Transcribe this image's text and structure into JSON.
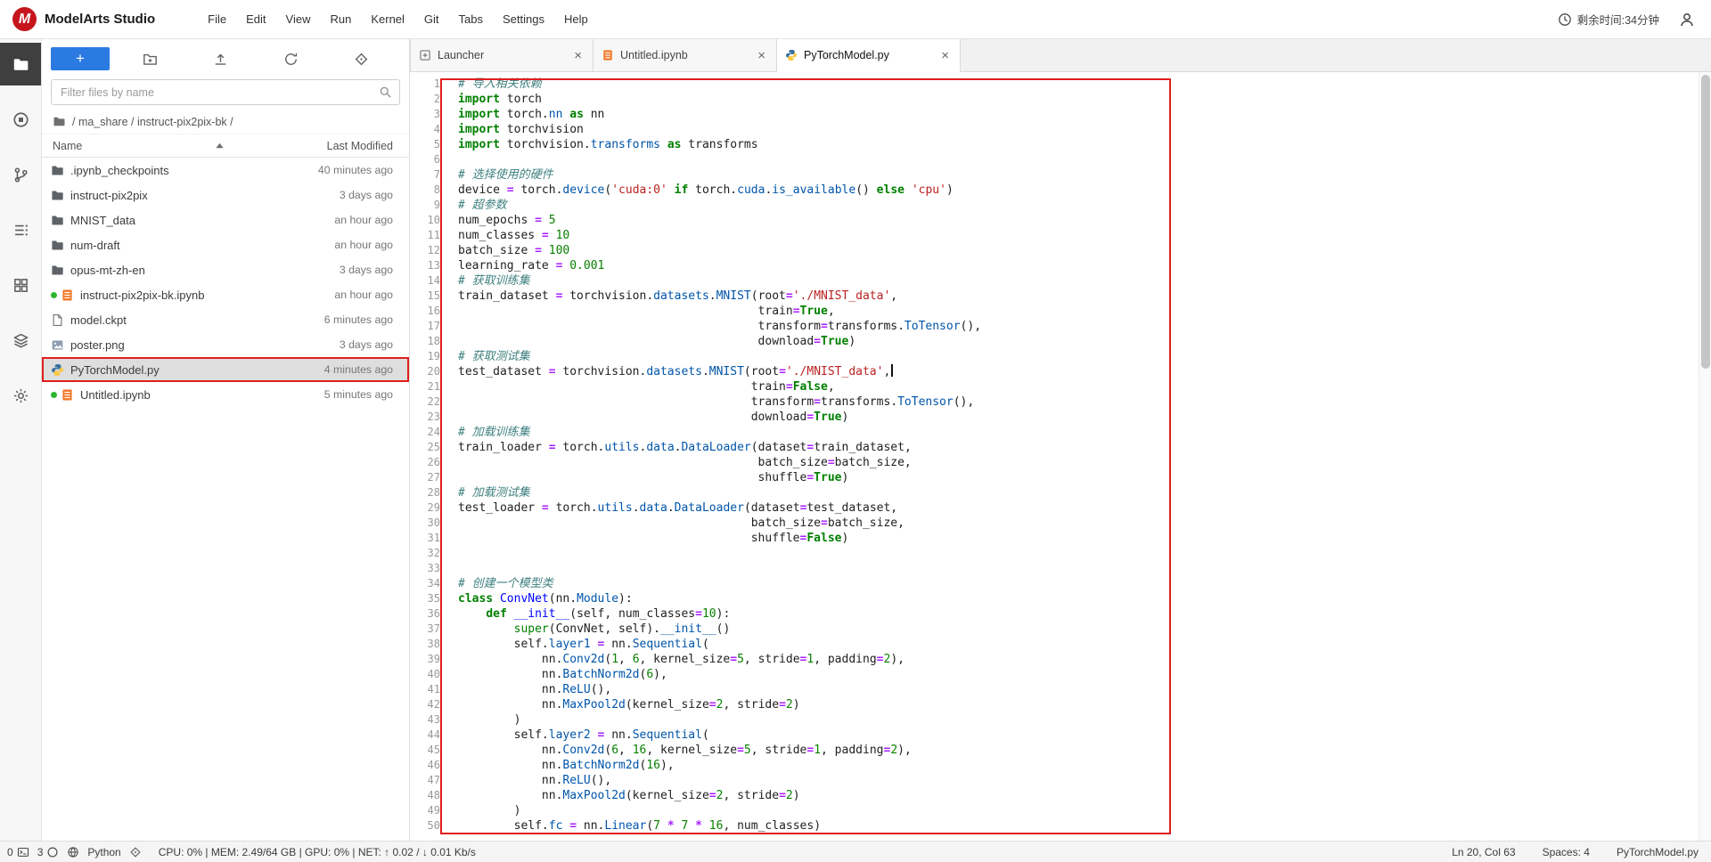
{
  "titlebar": {
    "app_name": "ModelArts Studio",
    "logo_glyph": "M",
    "menus": [
      "File",
      "Edit",
      "View",
      "Run",
      "Kernel",
      "Git",
      "Tabs",
      "Settings",
      "Help"
    ],
    "time_remaining": "剩余时间:34分钟"
  },
  "colors": {
    "accent_blue": "#2a7ae2",
    "brand_red": "#c5161d",
    "annotation_red": "#e11d1d",
    "running_dot_green": "#2db52d",
    "notebook_orange": "#f37726"
  },
  "activity_bar": {
    "items": [
      {
        "name": "file-browser",
        "icon": "folder",
        "active": true
      },
      {
        "name": "running-sessions",
        "icon": "running",
        "active": false
      },
      {
        "name": "git",
        "icon": "git",
        "active": false
      },
      {
        "name": "table-of-contents",
        "icon": "toc",
        "active": false
      },
      {
        "name": "extensions",
        "icon": "grid",
        "active": false
      },
      {
        "name": "snippets",
        "icon": "stack",
        "active": false
      },
      {
        "name": "settings",
        "icon": "gear",
        "active": false
      }
    ]
  },
  "file_browser": {
    "new_button_label": "+",
    "filter_placeholder": "Filter files by name",
    "breadcrumb": "/ ma_share / instruct-pix2pix-bk /",
    "columns": {
      "name": "Name",
      "modified": "Last Modified"
    },
    "files": [
      {
        "name": ".ipynb_checkpoints",
        "type": "folder",
        "modified": "40 minutes ago",
        "running": false,
        "selected": false
      },
      {
        "name": "instruct-pix2pix",
        "type": "folder",
        "modified": "3 days ago",
        "running": false,
        "selected": false
      },
      {
        "name": "MNIST_data",
        "type": "folder",
        "modified": "an hour ago",
        "running": false,
        "selected": false
      },
      {
        "name": "num-draft",
        "type": "folder",
        "modified": "an hour ago",
        "running": false,
        "selected": false
      },
      {
        "name": "opus-mt-zh-en",
        "type": "folder",
        "modified": "3 days ago",
        "running": false,
        "selected": false
      },
      {
        "name": "instruct-pix2pix-bk.ipynb",
        "type": "notebook",
        "modified": "an hour ago",
        "running": true,
        "selected": false
      },
      {
        "name": "model.ckpt",
        "type": "file",
        "modified": "6 minutes ago",
        "running": false,
        "selected": false
      },
      {
        "name": "poster.png",
        "type": "image",
        "modified": "3 days ago",
        "running": false,
        "selected": false
      },
      {
        "name": "PyTorchModel.py",
        "type": "python",
        "modified": "4 minutes ago",
        "running": false,
        "selected": true
      },
      {
        "name": "Untitled.ipynb",
        "type": "notebook",
        "modified": "5 minutes ago",
        "running": true,
        "selected": false
      }
    ]
  },
  "tabs": [
    {
      "label": "Launcher",
      "icon": "launcher",
      "active": false
    },
    {
      "label": "Untitled.ipynb",
      "icon": "notebook",
      "active": false
    },
    {
      "label": "PyTorchModel.py",
      "icon": "python",
      "active": true
    }
  ],
  "editor": {
    "annotated": true,
    "cursor_line": 20,
    "lines": [
      "# 导入相关依赖",
      "import torch",
      "import torch.nn as nn",
      "import torchvision",
      "import torchvision.transforms as transforms",
      "",
      "# 选择使用的硬件",
      "device = torch.device('cuda:0' if torch.cuda.is_available() else 'cpu')",
      "# 超参数",
      "num_epochs = 5",
      "num_classes = 10",
      "batch_size = 100",
      "learning_rate = 0.001",
      "# 获取训练集",
      "train_dataset = torchvision.datasets.MNIST(root='./MNIST_data',",
      "                                           train=True,",
      "                                           transform=transforms.ToTensor(),",
      "                                           download=True)",
      "# 获取测试集",
      "test_dataset = torchvision.datasets.MNIST(root='./MNIST_data',",
      "                                          train=False,",
      "                                          transform=transforms.ToTensor(),",
      "                                          download=True)",
      "# 加载训练集",
      "train_loader = torch.utils.data.DataLoader(dataset=train_dataset,",
      "                                           batch_size=batch_size,",
      "                                           shuffle=True)",
      "# 加载测试集",
      "test_loader = torch.utils.data.DataLoader(dataset=test_dataset,",
      "                                          batch_size=batch_size,",
      "                                          shuffle=False)",
      "",
      "",
      "# 创建一个模型类",
      "class ConvNet(nn.Module):",
      "    def __init__(self, num_classes=10):",
      "        super(ConvNet, self).__init__()",
      "        self.layer1 = nn.Sequential(",
      "            nn.Conv2d(1, 6, kernel_size=5, stride=1, padding=2),",
      "            nn.BatchNorm2d(6),",
      "            nn.ReLU(),",
      "            nn.MaxPool2d(kernel_size=2, stride=2)",
      "        )",
      "        self.layer2 = nn.Sequential(",
      "            nn.Conv2d(6, 16, kernel_size=5, stride=1, padding=2),",
      "            nn.BatchNorm2d(16),",
      "            nn.ReLU(),",
      "            nn.MaxPool2d(kernel_size=2, stride=2)",
      "        )",
      "        self.fc = nn.Linear(7 * 7 * 16, num_classes)"
    ]
  },
  "status_bar": {
    "terminals": "0",
    "kernels": "3",
    "language": "Python",
    "metrics": "CPU: 0% | MEM: 2.49/64 GB | GPU: 0% | NET: ↑ 0.02 / ↓ 0.01 Kb/s",
    "cursor_position": "Ln 20, Col 63",
    "indent": "Spaces: 4",
    "filename": "PyTorchModel.py"
  }
}
